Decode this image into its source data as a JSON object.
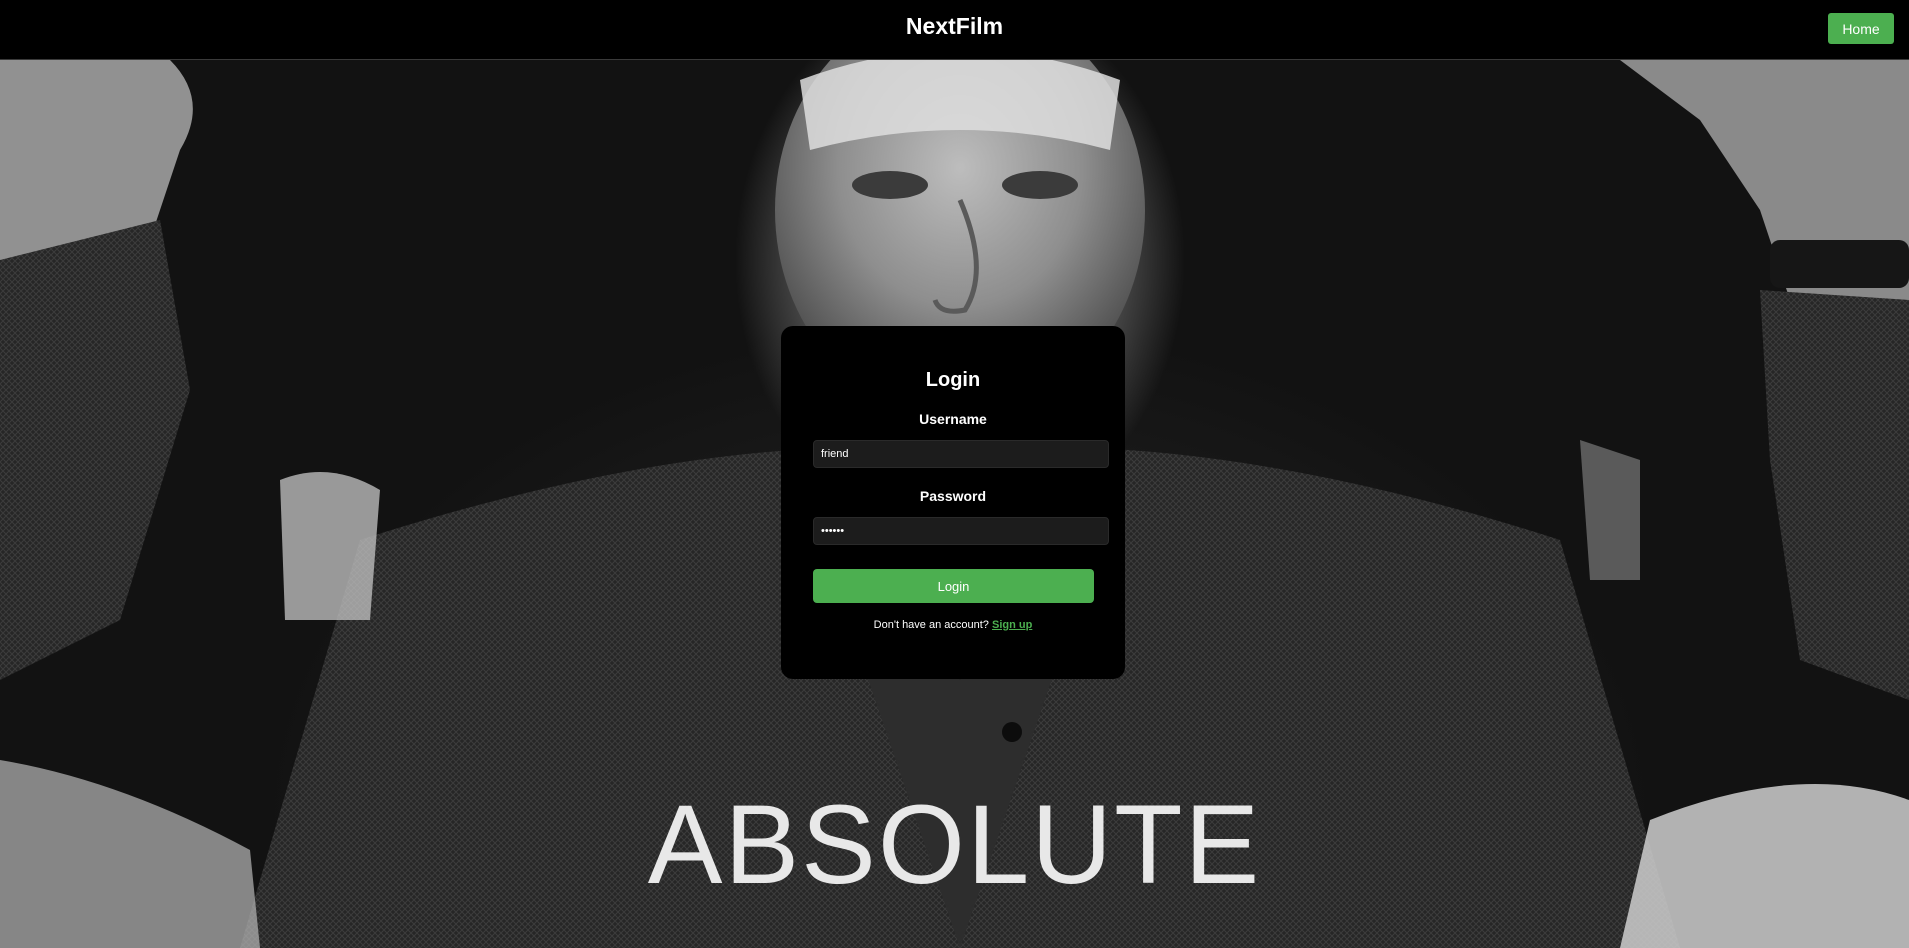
{
  "navbar": {
    "brand": "NextFilm",
    "home_label": "Home"
  },
  "hero": {
    "headline": "ABSOLUTE"
  },
  "login": {
    "title": "Login",
    "username_label": "Username",
    "username_value": "friend",
    "password_label": "Password",
    "password_value": "••••••",
    "submit_label": "Login",
    "signup_prompt": "Don't have an account?",
    "signup_link": "Sign up"
  },
  "colors": {
    "accent": "#4caf50",
    "card_bg": "#000000",
    "input_bg": "#1c1c1c"
  },
  "icons": {
    "hero_image": "portrait-photo"
  }
}
